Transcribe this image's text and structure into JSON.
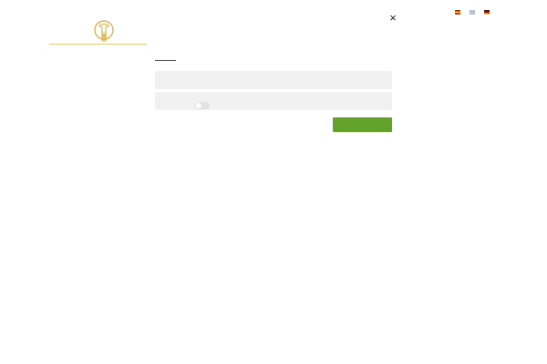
{
  "header": {
    "logo_icon": "bull-logo-icon",
    "close_icon": "close-icon",
    "close_label": "×"
  },
  "languages": [
    {
      "code": "es",
      "icon": "spain-flag-icon"
    },
    {
      "code": "en",
      "icon": "uk-flag-icon"
    },
    {
      "code": "de",
      "icon": "germany-flag-icon"
    }
  ],
  "form": {
    "field_1": {
      "value": "",
      "placeholder": ""
    },
    "field_2": {
      "value": "",
      "placeholder": ""
    },
    "toggle_checked": false,
    "submit_label": ""
  },
  "colors": {
    "accent": "#62a12a",
    "logo_gold": "#d9a93a",
    "field_bg": "#f1f1f1"
  }
}
